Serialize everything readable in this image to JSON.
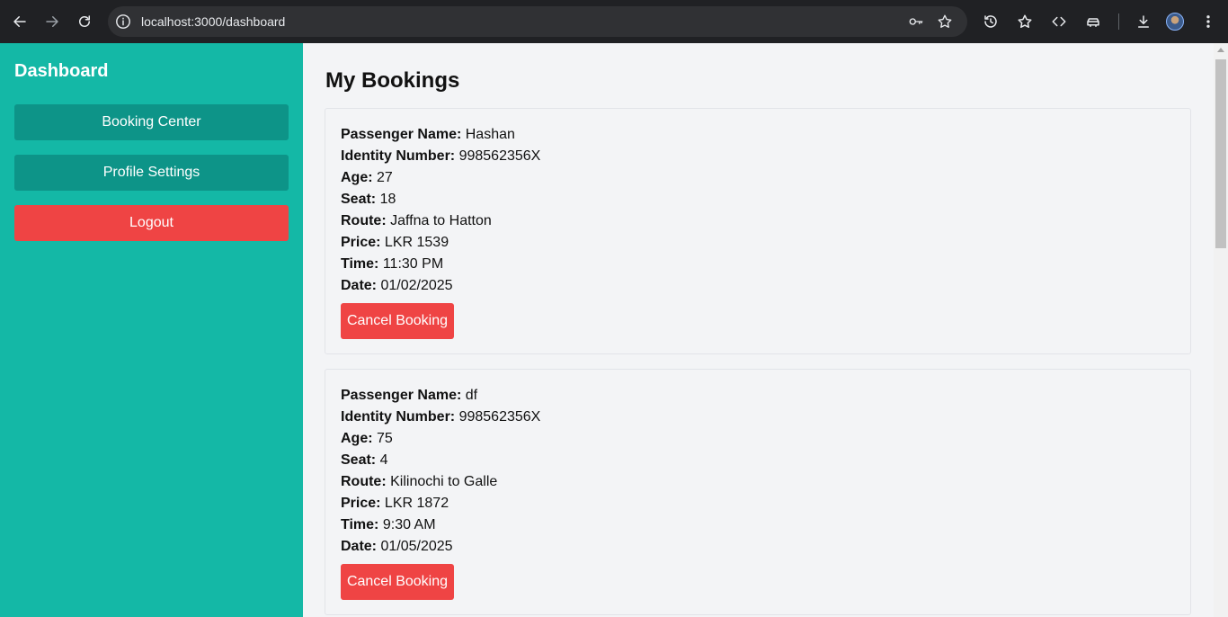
{
  "browser": {
    "url": "localhost:3000/dashboard"
  },
  "sidebar": {
    "title": "Dashboard",
    "items": [
      {
        "label": "Booking Center"
      },
      {
        "label": "Profile Settings"
      },
      {
        "label": "Logout"
      }
    ]
  },
  "main": {
    "title": "My Bookings",
    "field_labels": {
      "name": "Passenger Name:",
      "identity": "Identity Number:",
      "age": "Age:",
      "seat": "Seat:",
      "route": "Route:",
      "price": "Price:",
      "time": "Time:",
      "date": "Date:"
    },
    "cancel_label": "Cancel Booking",
    "bookings": [
      {
        "name": "Hashan",
        "identity": "998562356X",
        "age": "27",
        "seat": "18",
        "route": "Jaffna to Hatton",
        "price": "LKR 1539",
        "time": "11:30 PM",
        "date": "01/02/2025"
      },
      {
        "name": "df",
        "identity": "998562356X",
        "age": "75",
        "seat": "4",
        "route": "Kilinochi to Galle",
        "price": "LKR 1872",
        "time": "9:30 AM",
        "date": "01/05/2025"
      }
    ]
  },
  "colors": {
    "sidebar": "#14b8a6",
    "nav_button": "#0d9488",
    "danger": "#ef4444",
    "background": "#f3f4f6"
  }
}
